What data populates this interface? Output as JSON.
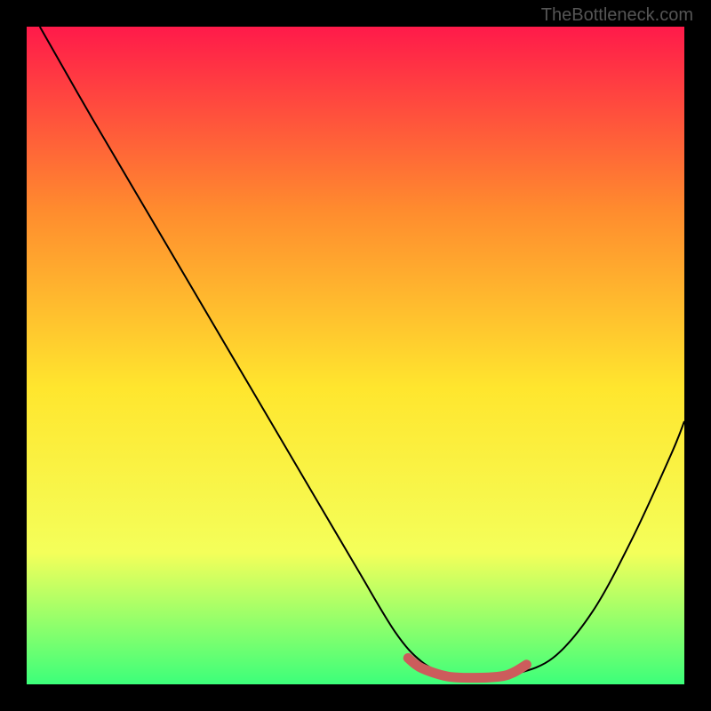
{
  "watermark": "TheBottleneck.com",
  "chart_data": {
    "type": "line",
    "title": "",
    "xlabel": "",
    "ylabel": "",
    "xlim": [
      0,
      100
    ],
    "ylim": [
      0,
      100
    ],
    "background_gradient": {
      "top": "#ff1a4a",
      "mid_top": "#ff8c2e",
      "mid": "#ffe62e",
      "mid_bottom": "#f4ff5a",
      "bottom": "#3cff7a"
    },
    "series": [
      {
        "name": "bottleneck-curve",
        "color": "#000000",
        "x": [
          2,
          10,
          20,
          30,
          40,
          50,
          56,
          60,
          64,
          68,
          70,
          74,
          80,
          86,
          92,
          98,
          100
        ],
        "y": [
          100,
          86,
          69,
          52,
          35,
          18,
          8,
          3.5,
          1.5,
          1,
          1,
          1.5,
          4,
          11,
          22,
          35,
          40
        ]
      },
      {
        "name": "highlight-band",
        "color": "#cc5c5c",
        "x": [
          58,
          60,
          64,
          68,
          72,
          74,
          76
        ],
        "y": [
          4,
          2.5,
          1.2,
          1,
          1.2,
          1.8,
          3
        ]
      }
    ]
  }
}
